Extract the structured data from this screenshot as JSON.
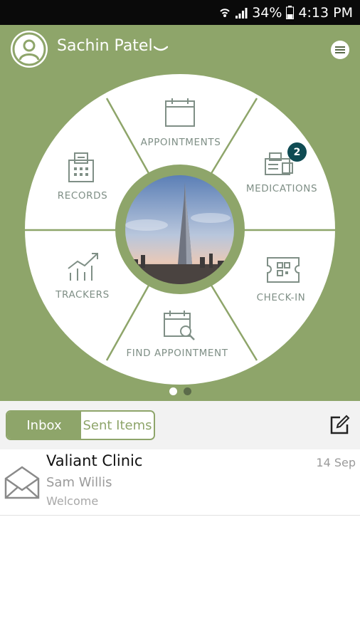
{
  "status_bar": {
    "battery": "34%",
    "time": "4:13 PM",
    "icons": [
      "wifi-icon",
      "signal-icon",
      "battery-icon"
    ]
  },
  "header": {
    "user_name": "Sachin Patel",
    "avatar_icon": "user-avatar-icon",
    "menu_icon": "menu-icon"
  },
  "hub": {
    "segments": [
      {
        "label": "APPOINTMENTS",
        "icon": "calendar-icon"
      },
      {
        "label": "MEDICATIONS",
        "icon": "pharmacy-icon",
        "badge": "2"
      },
      {
        "label": "CHECK-IN",
        "icon": "qr-ticket-icon"
      },
      {
        "label": "FIND APPOINTMENT",
        "icon": "calendar-search-icon"
      },
      {
        "label": "TRACKERS",
        "icon": "chart-trend-icon"
      },
      {
        "label": "RECORDS",
        "icon": "records-icon"
      }
    ],
    "center_image": "city-skyline-photo",
    "pages": 2,
    "current_page": 1
  },
  "tabs": {
    "inbox": "Inbox",
    "sent": "Sent Items",
    "active": "Inbox",
    "compose_icon": "compose-icon"
  },
  "messages": [
    {
      "title": "Valiant Clinic",
      "sender": "Sam Willis",
      "preview": "Welcome",
      "date": "14 Sep",
      "icon": "envelope-icon"
    }
  ],
  "colors": {
    "accent": "#8ea56a",
    "badge": "#0f4b53",
    "label": "#7f8f86"
  }
}
